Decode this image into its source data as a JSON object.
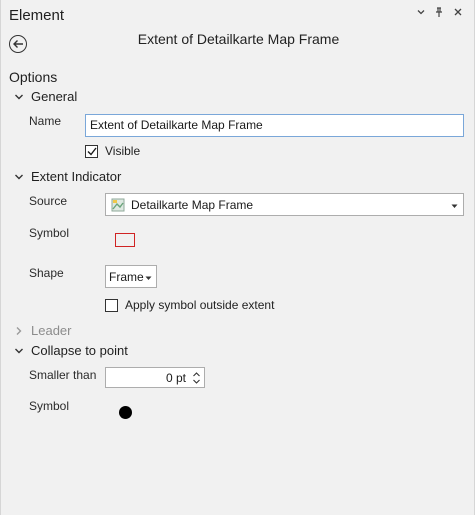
{
  "window": {
    "title": "Element",
    "controls": [
      "menu-icon",
      "pin-icon",
      "close-icon"
    ]
  },
  "header": {
    "back_icon": "back-arrow-icon",
    "element_title": "Extent of Detailkarte Map Frame"
  },
  "options_label": "Options",
  "general": {
    "section_label": "General",
    "name_label": "Name",
    "name_value": "Extent of Detailkarte Map Frame",
    "visible_label": "Visible",
    "visible_checked": true
  },
  "extent_indicator": {
    "section_label": "Extent Indicator",
    "source_label": "Source",
    "source_value": "Detailkarte Map Frame",
    "source_icon": "map-frame-icon",
    "symbol_label": "Symbol",
    "symbol_color": "#d02424",
    "shape_label": "Shape",
    "shape_value": "Frame",
    "apply_outside_label": "Apply symbol outside extent",
    "apply_outside_checked": false
  },
  "leader": {
    "section_label": "Leader"
  },
  "collapse": {
    "section_label": "Collapse to point",
    "smaller_than_label": "Smaller than",
    "smaller_than_value": "0 pt",
    "symbol_label": "Symbol",
    "symbol_color": "#000000"
  }
}
